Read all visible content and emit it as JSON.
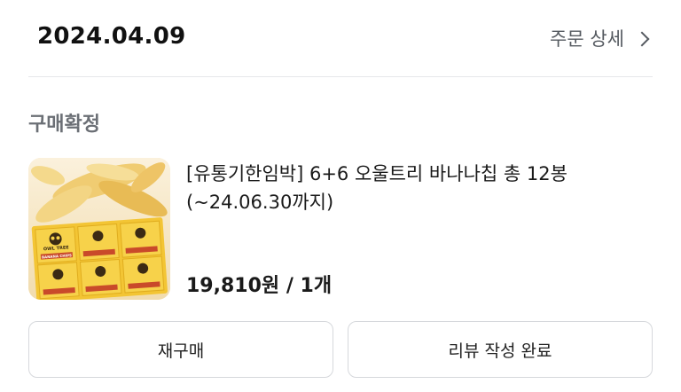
{
  "order": {
    "date": "2024.04.09",
    "detail_label": "주문 상세"
  },
  "status": "구매확정",
  "product": {
    "name": "[유통기한임박] 6+6 오울트리 바나나칩 총 12봉 (~24.06.30까지)",
    "price": "19,810원",
    "quantity": "1개",
    "package_text": [
      "OWL TREE",
      "BANANA CHIPS"
    ]
  },
  "actions": {
    "rebuy": "재구매",
    "review": "리뷰 작성 완료"
  }
}
